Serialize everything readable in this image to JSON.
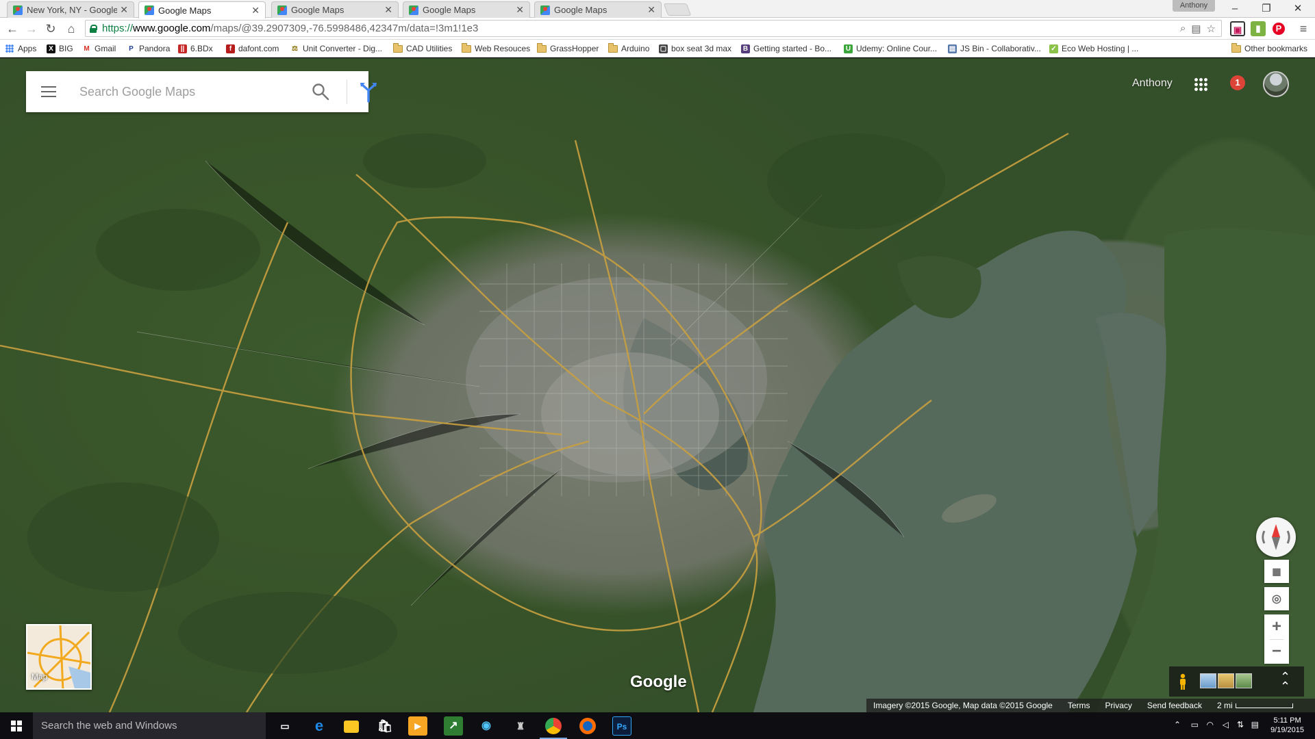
{
  "browser": {
    "tabs": [
      {
        "title": "New York, NY - Google M",
        "active": false
      },
      {
        "title": "Google Maps",
        "active": true
      },
      {
        "title": "Google Maps",
        "active": false
      },
      {
        "title": "Google Maps",
        "active": false
      },
      {
        "title": "Google Maps",
        "active": false
      }
    ],
    "profile_name": "Anthony",
    "url": {
      "scheme": "https://",
      "host": "www.google.com",
      "path": "/maps/@39.2907309,-76.5998486,42347m/data=!3m1!1e3"
    },
    "bookmarks": [
      {
        "label": "Apps",
        "icon": "apps-grid-icon"
      },
      {
        "label": "BIG",
        "icon": "big-icon"
      },
      {
        "label": "Gmail",
        "icon": "gmail-icon"
      },
      {
        "label": "Pandora",
        "icon": "pandora-icon"
      },
      {
        "label": "6.BDx",
        "icon": "bdx-icon"
      },
      {
        "label": "dafont.com",
        "icon": "dafont-icon"
      },
      {
        "label": "Unit Converter - Dig...",
        "icon": "converter-icon"
      },
      {
        "label": "CAD Utilities",
        "icon": "folder-icon"
      },
      {
        "label": "Web Resouces",
        "icon": "folder-icon"
      },
      {
        "label": "GrassHopper",
        "icon": "folder-icon"
      },
      {
        "label": "Arduino",
        "icon": "folder-icon"
      },
      {
        "label": "box seat 3d max",
        "icon": "box-icon"
      },
      {
        "label": "Getting started - Bo...",
        "icon": "bootstrap-icon"
      },
      {
        "label": "Udemy: Online Cour...",
        "icon": "udemy-icon"
      },
      {
        "label": "JS Bin - Collaborativ...",
        "icon": "jsbin-icon"
      },
      {
        "label": "Eco Web Hosting | ...",
        "icon": "eco-icon"
      }
    ],
    "other_bookmarks": "Other bookmarks"
  },
  "maps": {
    "search_placeholder": "Search Google Maps",
    "user_name": "Anthony",
    "notification_count": "1",
    "mini_map_label": "Map",
    "logo": "Google",
    "footer": {
      "attribution": "Imagery ©2015 Google, Map data ©2015 Google",
      "terms": "Terms",
      "privacy": "Privacy",
      "feedback": "Send feedback",
      "scale": "2 mi"
    }
  },
  "taskbar": {
    "search_placeholder": "Search the web and Windows",
    "time": "5:11 PM",
    "date": "9/19/2015"
  },
  "colors": {
    "omnibox_secure": "#0b8043",
    "notification_badge": "#db4437",
    "highway": "#c9a040"
  }
}
